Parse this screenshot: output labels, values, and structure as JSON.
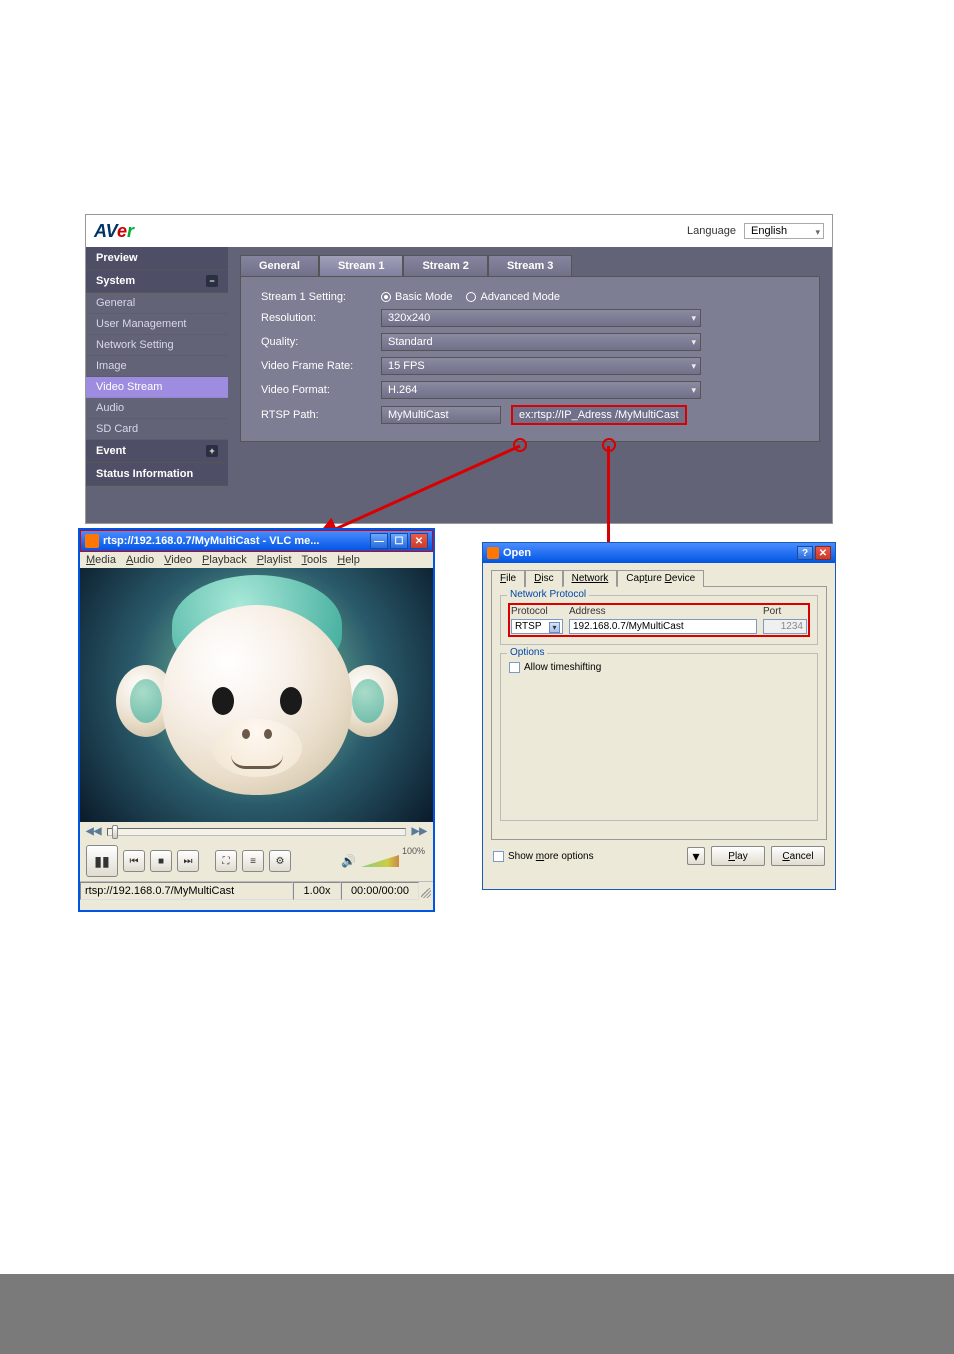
{
  "app": {
    "logo_parts": {
      "a": "A",
      "v": "V",
      "e": "e",
      "r": "r"
    },
    "language_label": "Language",
    "language_value": "English"
  },
  "sidebar": {
    "preview": "Preview",
    "system": "System",
    "items": [
      "General",
      "User Management",
      "Network Setting",
      "Image",
      "Video Stream",
      "Audio",
      "SD Card"
    ],
    "event": "Event",
    "status_info": "Status Information"
  },
  "tabs": [
    "General",
    "Stream 1",
    "Stream 2",
    "Stream 3"
  ],
  "form": {
    "setting_label": "Stream 1 Setting:",
    "basic": "Basic Mode",
    "advanced": "Advanced Mode",
    "resolution_label": "Resolution:",
    "resolution_value": "320x240",
    "quality_label": "Quality:",
    "quality_value": "Standard",
    "frame_label": "Video Frame Rate:",
    "frame_value": "15 FPS",
    "format_label": "Video Format:",
    "format_value": "H.264",
    "rtsp_label": "RTSP Path:",
    "rtsp_value": "MyMultiCast",
    "rtsp_hint": "ex:rtsp://IP_Adress /MyMultiCast"
  },
  "vlc": {
    "title": "rtsp://192.168.0.7/MyMultiCast - VLC me...",
    "menu": [
      "Media",
      "Audio",
      "Video",
      "Playback",
      "Playlist",
      "Tools",
      "Help"
    ],
    "rewind": "◀◀",
    "ffwd": "▶▶",
    "volume_pct": "100%",
    "status_path": "rtsp://192.168.0.7/MyMultiCast",
    "status_rate": "1.00x",
    "status_time": "00:00/00:00"
  },
  "open": {
    "title": "Open",
    "tabs": [
      "File",
      "Disc",
      "Network",
      "Capture Device"
    ],
    "network_protocol_legend": "Network Protocol",
    "protocol_label": "Protocol",
    "protocol_value": "RTSP",
    "address_label": "Address",
    "address_value": "192.168.0.7/MyMultiCast",
    "port_label": "Port",
    "port_value": "1234",
    "options_legend": "Options",
    "allow_timeshift": "Allow timeshifting",
    "show_more": "Show more options",
    "play": "Play",
    "cancel": "Cancel"
  }
}
